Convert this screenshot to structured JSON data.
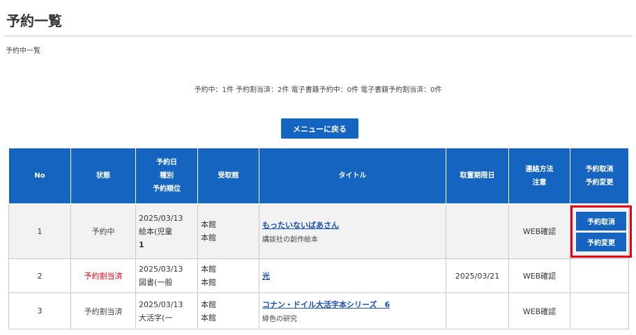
{
  "page": {
    "title": "予約一覧",
    "subtitle": "予約中一覧",
    "summary": "予約中：1件 予約割当済：2件 電子書籍予約中：0件 電子書籍予約割当済：0件",
    "menu_button": "メニューに戻る"
  },
  "table": {
    "headers": {
      "no": "No",
      "status": "状態",
      "date": [
        "予約日",
        "種別",
        "予約順位"
      ],
      "library": "受取館",
      "title": "タイトル",
      "deadline": "取置期限日",
      "contact": [
        "連絡方法",
        "注意"
      ],
      "action": [
        "予約取消",
        "予約変更"
      ]
    },
    "rows": [
      {
        "no": "1",
        "status": "予約中",
        "date": "2025/03/13",
        "kind": "絵本(児童",
        "rank": "1",
        "library1": "本館",
        "library2": "本館",
        "title": "もったいないばあさん",
        "subtitle": "講談社の創作絵本",
        "deadline": "",
        "contact": "WEB確認",
        "cancel": "予約取消",
        "change": "予約変更"
      },
      {
        "no": "2",
        "status": "予約割当済",
        "date": "2025/03/13",
        "kind": "図書(一般",
        "rank": "",
        "library1": "本館",
        "library2": "本館",
        "title": "光",
        "subtitle": "",
        "deadline": "2025/03/21",
        "contact": "WEB確認"
      },
      {
        "no": "3",
        "status": "予約割当済",
        "date": "2025/03/13",
        "kind": "大活字(一",
        "rank": "",
        "library1": "本館",
        "library2": "本館",
        "title": "コナン・ドイル大活字本シリーズ　6",
        "subtitle": "緋色の研究",
        "deadline": "",
        "contact": "WEB確認"
      }
    ]
  },
  "colors": {
    "header_bg": "#1565c0",
    "highlight": "#e60012",
    "link": "#1a4fb3"
  }
}
